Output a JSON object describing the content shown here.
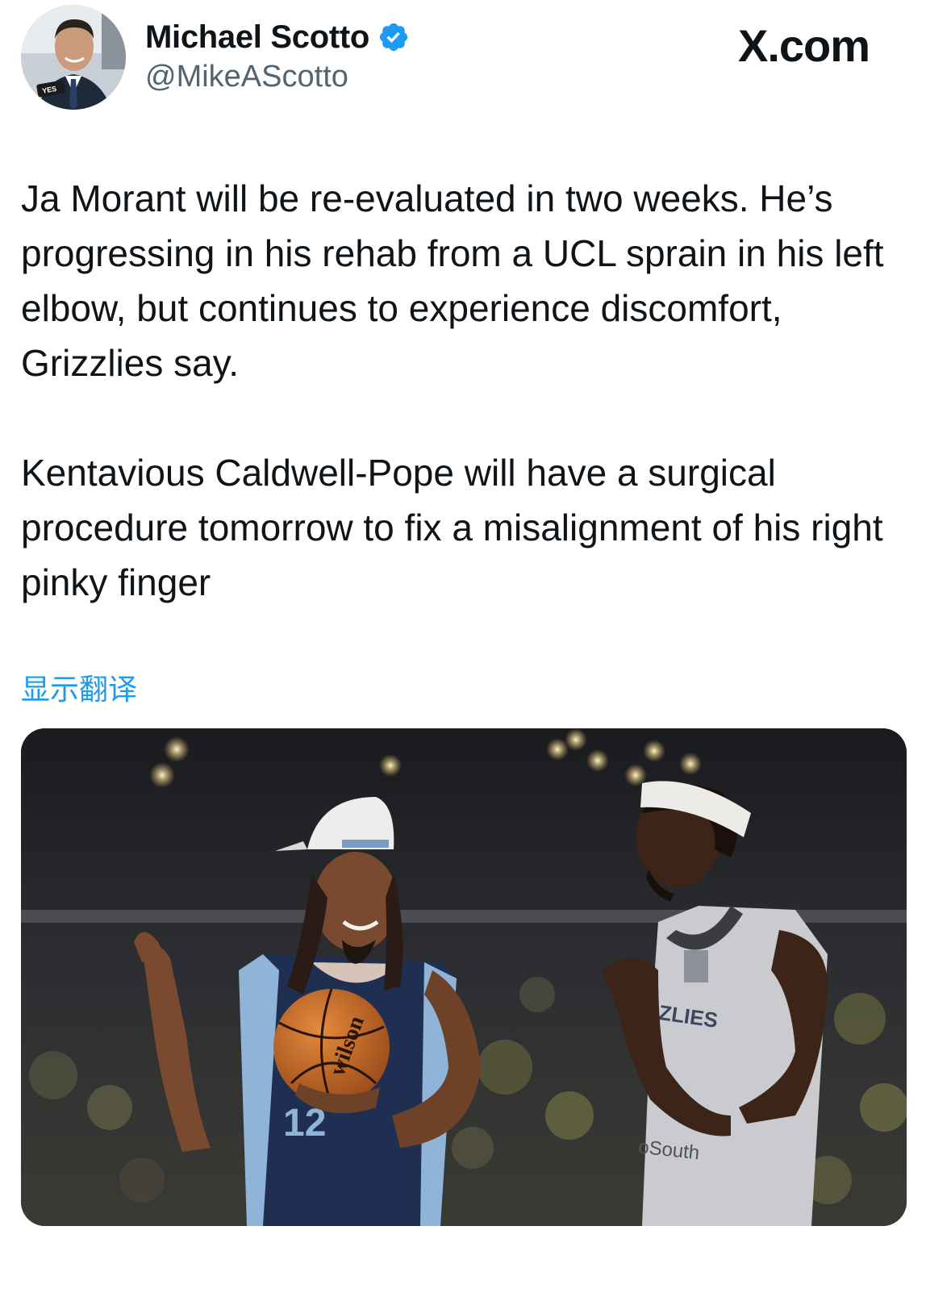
{
  "author": {
    "name": "Michael Scotto",
    "handle": "@MikeAScotto",
    "verified": true,
    "avatar_icon": "profile-photo",
    "avatar_badge_text": "YES"
  },
  "brand": "X.com",
  "tweet": {
    "paragraphs": [
      "Ja Morant will be re-evaluated in two weeks. He’s progressing in his rehab from a UCL sprain in his left elbow, but continues to experience discomfort, Grizzlies say.",
      "Kentavious Caldwell-Pope will have a surgical procedure tomorrow to fix a misalignment of his right pinky finger"
    ],
    "translate_link": "显示翻译"
  },
  "media": {
    "jersey_text_right": "ZLIES",
    "jersey_sponsor_right": "oSouth",
    "ball_brand": "wilson",
    "jersey_number_left": "12"
  },
  "colors": {
    "link": "#1d9bf0",
    "verified": "#1d9bf0",
    "text": "#0f1419",
    "secondary": "#536471"
  }
}
